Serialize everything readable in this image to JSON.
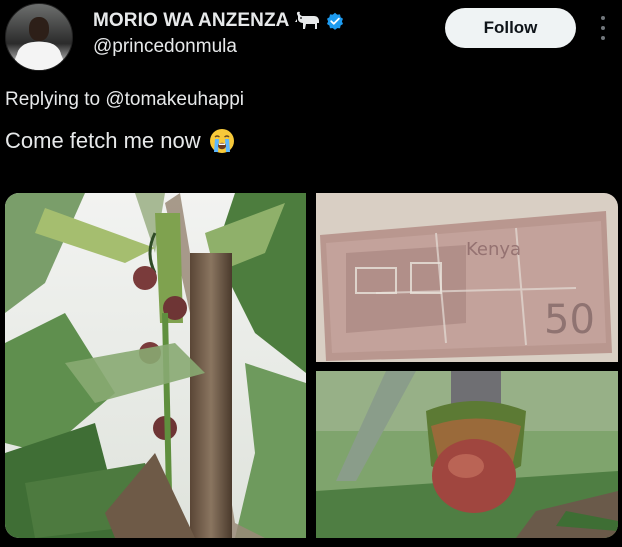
{
  "author": {
    "display_name": "MORIO WA ANZENZA",
    "handle": "@princedonmula",
    "badge_icon": "goat-icon",
    "verified_icon": "verified-badge-icon",
    "verified_color": "#1d9bf0"
  },
  "actions": {
    "follow_label": "Follow",
    "more_icon": "more-vertical-icon"
  },
  "reply": {
    "prefix": "Replying to",
    "mention": "@tomakeuhappi"
  },
  "tweet": {
    "text": "Come fetch me now",
    "emoji_icon": "loudly-crying-face-icon"
  },
  "media": {
    "images": [
      {
        "name": "banana-plant-photo"
      },
      {
        "name": "worn-banknote-photo",
        "note_text": "Kenya",
        "note_value": "50"
      },
      {
        "name": "banana-flower-stem-photo"
      }
    ]
  },
  "colors": {
    "background": "#000000",
    "text": "#e7e9ea",
    "follow_bg": "#eff3f4",
    "follow_text": "#0f1419",
    "muted": "#71767b"
  }
}
